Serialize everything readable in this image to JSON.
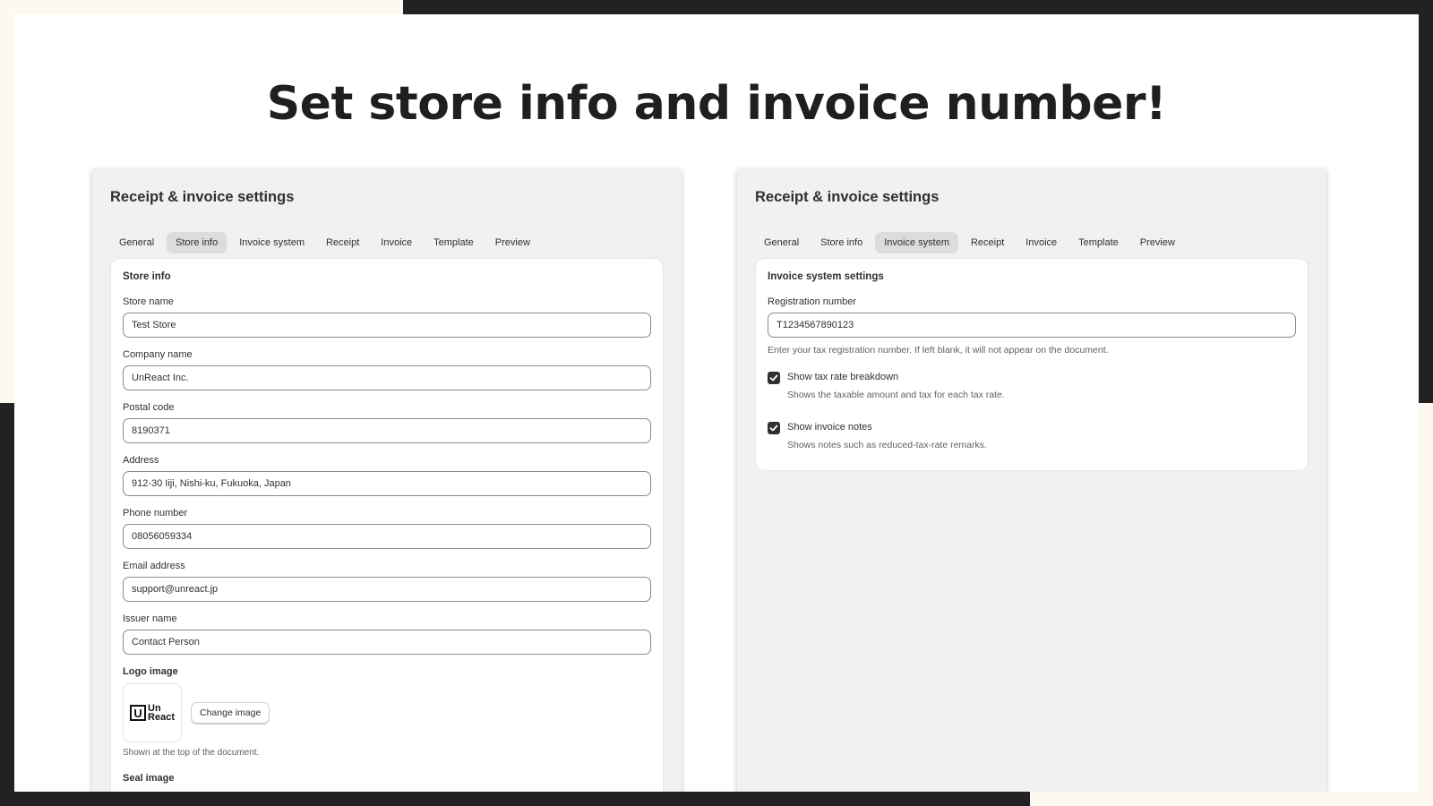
{
  "headline": "Set store info and invoice number!",
  "left_panel": {
    "title": "Receipt & invoice settings",
    "tabs": [
      {
        "label": "General",
        "active": false
      },
      {
        "label": "Store info",
        "active": true
      },
      {
        "label": "Invoice system",
        "active": false
      },
      {
        "label": "Receipt",
        "active": false
      },
      {
        "label": "Invoice",
        "active": false
      },
      {
        "label": "Template",
        "active": false
      },
      {
        "label": "Preview",
        "active": false
      }
    ],
    "card_title": "Store info",
    "fields": [
      {
        "label": "Store name",
        "value": "Test Store"
      },
      {
        "label": "Company name",
        "value": "UnReact Inc."
      },
      {
        "label": "Postal code",
        "value": "8190371"
      },
      {
        "label": "Address",
        "value": "912-30 Iiji, Nishi-ku, Fukuoka, Japan"
      },
      {
        "label": "Phone number",
        "value": "08056059334"
      },
      {
        "label": "Email address",
        "value": "support@unreact.jp"
      },
      {
        "label": "Issuer name",
        "value": "Contact Person"
      }
    ],
    "logo": {
      "label": "Logo image",
      "logo_letter": "U",
      "logo_line1": "Un",
      "logo_line2": "React",
      "change_button": "Change image",
      "help": "Shown at the top of the document."
    },
    "seal_label": "Seal image"
  },
  "right_panel": {
    "title": "Receipt & invoice settings",
    "tabs": [
      {
        "label": "General",
        "active": false
      },
      {
        "label": "Store info",
        "active": false
      },
      {
        "label": "Invoice system",
        "active": true
      },
      {
        "label": "Receipt",
        "active": false
      },
      {
        "label": "Invoice",
        "active": false
      },
      {
        "label": "Template",
        "active": false
      },
      {
        "label": "Preview",
        "active": false
      }
    ],
    "card_title": "Invoice system settings",
    "registration": {
      "label": "Registration number",
      "value": "T1234567890123",
      "help": "Enter your tax registration number. If left blank, it will not appear on the document."
    },
    "checks": [
      {
        "label": "Show tax rate breakdown",
        "help": "Shows the taxable amount and tax for each tax rate.",
        "checked": true
      },
      {
        "label": "Show invoice notes",
        "help": "Shows notes such as reduced-tax-rate remarks.",
        "checked": true
      }
    ]
  }
}
